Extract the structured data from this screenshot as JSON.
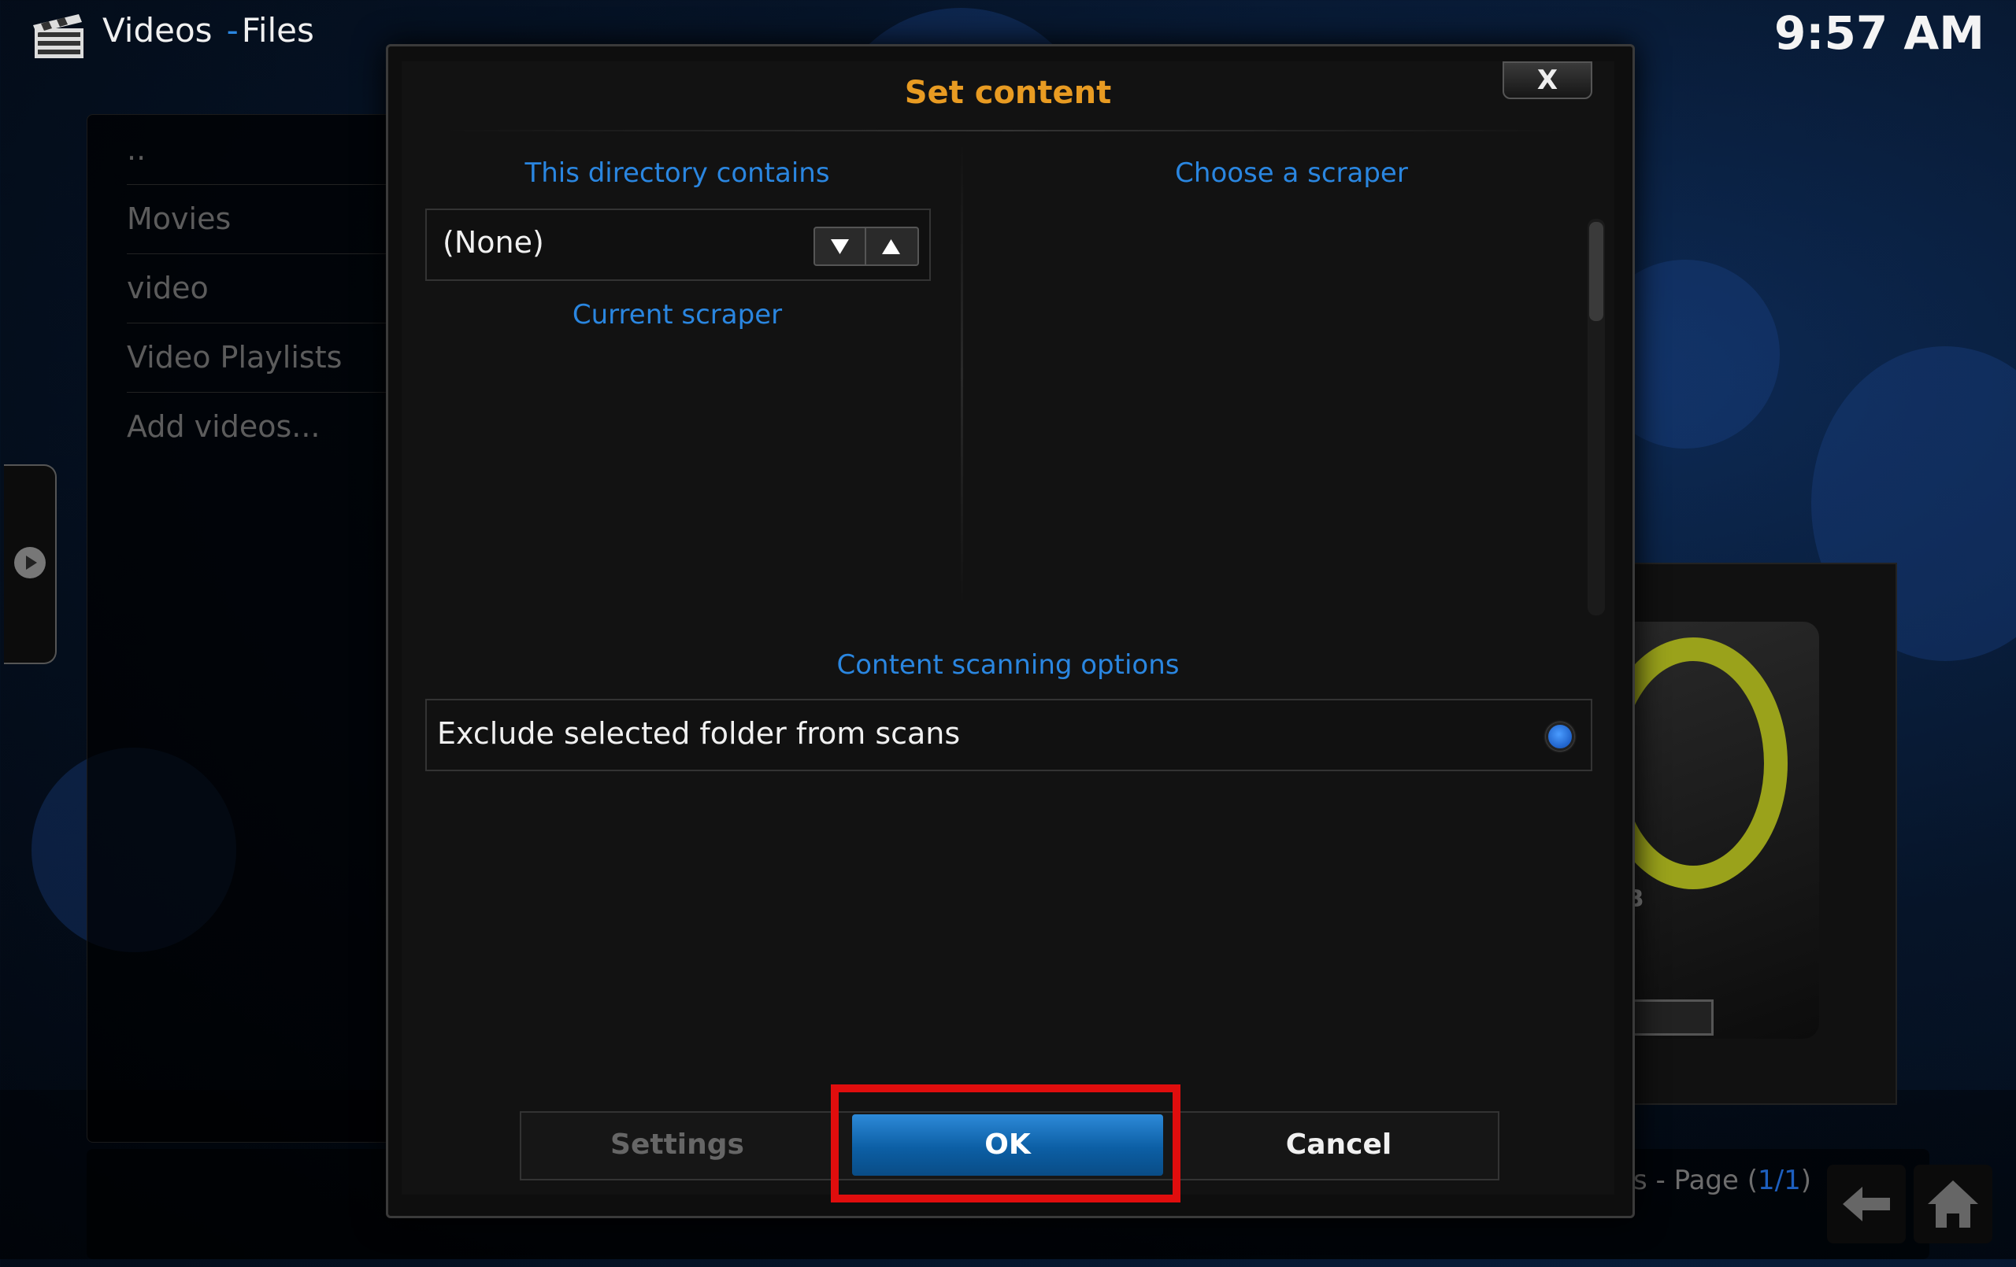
{
  "header": {
    "icon": "clapperboard-icon",
    "section": "Videos",
    "separator": "-",
    "view": "Files",
    "clock": "9:57 AM"
  },
  "file_list": {
    "items": [
      {
        "label": ".."
      },
      {
        "label": "Movies"
      },
      {
        "label": "video"
      },
      {
        "label": "Video Playlists"
      },
      {
        "label": "Add videos..."
      }
    ]
  },
  "footer": {
    "page_prefix": "ms - Page (",
    "page_current": "1/1",
    "page_suffix": ")"
  },
  "thumbnail": {
    "gb_text": "GB"
  },
  "dialog": {
    "title": "Set content",
    "close_label": "X",
    "directory_contains_label": "This directory contains",
    "content_type_value": "(None)",
    "current_scraper_label": "Current scraper",
    "choose_scraper_label": "Choose a scraper",
    "scanning_options_label": "Content scanning options",
    "exclude_label": "Exclude selected folder from scans",
    "buttons": {
      "settings": "Settings",
      "ok": "OK",
      "cancel": "Cancel"
    }
  },
  "colors": {
    "accent_blue": "#2a86e0",
    "title_orange": "#e89b22",
    "highlight_red": "#e00d0d"
  }
}
